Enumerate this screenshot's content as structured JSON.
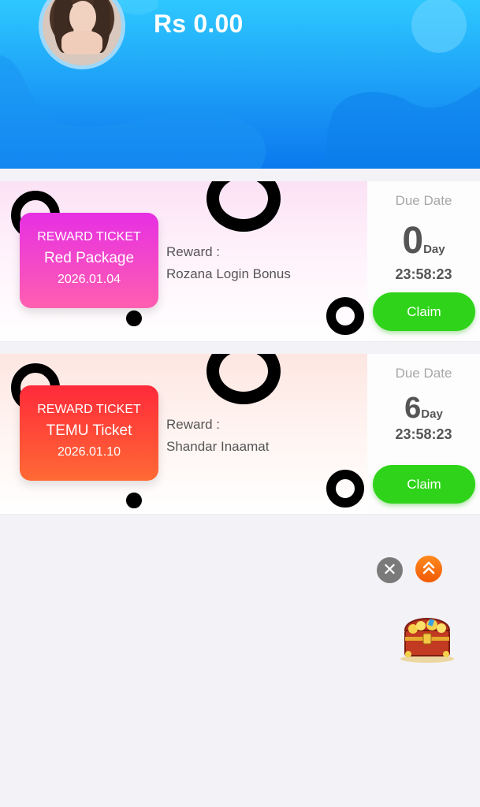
{
  "header": {
    "balance": "Rs 0.00"
  },
  "rewards": [
    {
      "ticket_heading": "REWARD TICKET",
      "ticket_name": "Red Package",
      "ticket_date": "2026.01.04",
      "reward_label": "Reward :",
      "reward_value": "Rozana Login Bonus",
      "due_label": "Due Date",
      "days": "0",
      "days_unit": "Day",
      "time": "23:58:23",
      "claim_label": "Claim"
    },
    {
      "ticket_heading": "REWARD TICKET",
      "ticket_name": "TEMU Ticket",
      "ticket_date": "2026.01.10",
      "reward_label": "Reward :",
      "reward_value": "Shandar Inaamat",
      "due_label": "Due Date",
      "days": "6",
      "days_unit": "Day",
      "time": "23:58:23",
      "claim_label": "Claim"
    }
  ],
  "floating": {
    "close_icon": "close-icon",
    "top_icon": "double-chevron-up-icon",
    "chest_icon": "treasure-chest-icon"
  },
  "colors": {
    "header_blue": "#1fa4f8",
    "claim_green": "#2fd41a",
    "ticket_pink": "#e62fe3",
    "ticket_red": "#ff2a3a",
    "top_button_orange": "#f15a05"
  }
}
